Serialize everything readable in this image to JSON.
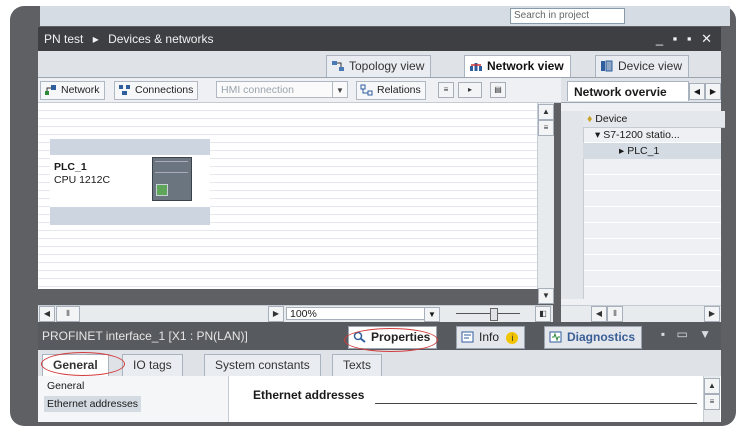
{
  "app": {
    "search_placeholder": "Search in project"
  },
  "titlebar": {
    "project": "PN test",
    "separator": "▸",
    "section": "Devices & networks",
    "window_controls": "_ ▪ ▪ ✕"
  },
  "view_tabs": [
    {
      "label": "Topology view",
      "icon": "topology-icon"
    },
    {
      "label": "Network view",
      "icon": "network-icon",
      "active": true
    },
    {
      "label": "Device view",
      "icon": "device-icon"
    }
  ],
  "toolbar": {
    "network_label": "Network",
    "connections_label": "Connections",
    "hmi_connection_value": "HMI connection",
    "relations_label": "Relations"
  },
  "canvas": {
    "device_name": "PLC_1",
    "device_type": "CPU 1212C"
  },
  "zoom": {
    "value": "100%"
  },
  "overview": {
    "tab_label": "Network overvie",
    "column_header": "Device",
    "rows": [
      {
        "label": "S7-1200 statio...",
        "expanded": true
      },
      {
        "label": "PLC_1",
        "selected": true
      }
    ]
  },
  "properties_bar": {
    "title": "PROFINET interface_1 [X1 : PN(LAN)]",
    "tabs": [
      {
        "label": "Properties",
        "icon": "properties-icon",
        "active": true,
        "highlighted": true
      },
      {
        "label": "Info",
        "icon": "info-icon"
      },
      {
        "label": "Diagnostics",
        "icon": "diagnostics-icon"
      }
    ]
  },
  "sub_tabs": [
    {
      "label": "General",
      "active": true,
      "highlighted": true
    },
    {
      "label": "IO tags"
    },
    {
      "label": "System constants"
    },
    {
      "label": "Texts"
    }
  ],
  "left_nav": [
    {
      "label": "General"
    },
    {
      "label": "Ethernet addresses",
      "selected": true
    }
  ],
  "content": {
    "section_title": "Ethernet addresses"
  },
  "colors": {
    "title_bar": "#3d3f43",
    "properties_bar": "#575a5f",
    "highlight_circle": "#d23b3b",
    "port_green": "#5fa55a"
  }
}
